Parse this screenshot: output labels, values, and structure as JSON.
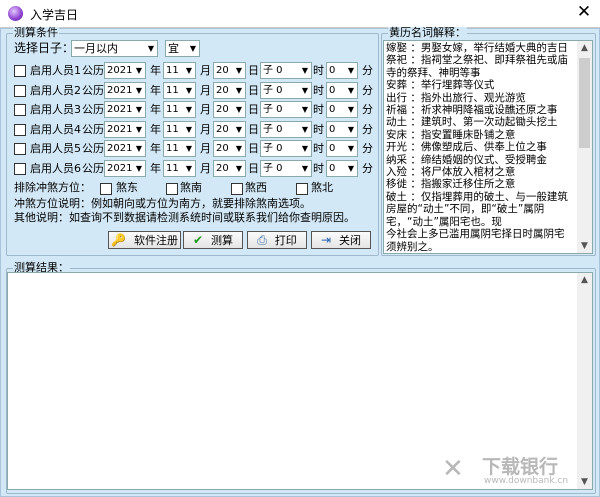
{
  "window": {
    "title": "入学吉日",
    "close": "✕"
  },
  "conditions": {
    "group_label": "测算条件",
    "select_day_label": "选择日子：",
    "range": "一月以内",
    "type": "宜",
    "persons": [
      {
        "label": "启用人员1",
        "calendar": "公历",
        "year": "2021",
        "month": "11",
        "day": "20",
        "hour": "子 0",
        "minute": "0",
        "checked": false
      },
      {
        "label": "启用人员2",
        "calendar": "公历",
        "year": "2021",
        "month": "11",
        "day": "20",
        "hour": "子 0",
        "minute": "0",
        "checked": false
      },
      {
        "label": "启用人员3",
        "calendar": "公历",
        "year": "2021",
        "month": "11",
        "day": "20",
        "hour": "子 0",
        "minute": "0",
        "checked": false
      },
      {
        "label": "启用人员4",
        "calendar": "公历",
        "year": "2021",
        "month": "11",
        "day": "20",
        "hour": "子 0",
        "minute": "0",
        "checked": false
      },
      {
        "label": "启用人员5",
        "calendar": "公历",
        "year": "2021",
        "month": "11",
        "day": "20",
        "hour": "子 0",
        "minute": "0",
        "checked": false
      },
      {
        "label": "启用人员6",
        "calendar": "公历",
        "year": "2021",
        "month": "11",
        "day": "20",
        "hour": "子 0",
        "minute": "0",
        "checked": false
      }
    ],
    "units": {
      "year": "年",
      "month": "月",
      "day": "日",
      "hour": "时",
      "minute": "分"
    },
    "exclude_label": "排除冲煞方位：",
    "directions": [
      "煞东",
      "煞南",
      "煞西",
      "煞北"
    ],
    "note1": "冲煞方位说明：例如朝向或方位为南方，就要排除煞南选项。",
    "note2": "其他说明：如查询不到数据请检测系统时间或联系我们给你查明原因。",
    "buttons": {
      "register": "软件注册",
      "calculate": "测算",
      "print": "打印",
      "close": "关闭"
    }
  },
  "glossary": {
    "group_label": "黄历名词解释：",
    "lines": [
      "嫁娶 ：男娶女嫁，举行结婚大典的吉日",
      "祭祀 ：指祠堂之祭祀、即拜祭祖先或庙",
      "寺的祭拜、神明等事",
      "安葬 ：举行埋葬等仪式",
      "出行 ：指外出旅行、观光游览",
      "祈福 ：祈求神明降福或设醮还原之事",
      "动土 ：建筑时、第一次动起锄头挖土",
      "安床 ：指安置睡床卧铺之意",
      "开光 ：佛像塑成后、供奉上位之事",
      "纳采 ：缔结婚姻的仪式、受授聘金",
      "入殓 ：将尸体放入棺材之意",
      "移徙 ：指搬家迁移住所之意",
      "破土 ：仅指埋葬用的破土、与一般建筑",
      "房屋的“动土”不同，即“破土”属阴",
      "宅，“动土”属阳宅也。现",
      "今社会上多已滥用属阴宅择日时属阴宅",
      "须辨别之。",
      "解除 ：指冲洗清扫宅舍、解除灾厄等事",
      "入宅 ：即迁入新宅、所谓“新居落成典"
    ]
  },
  "results": {
    "group_label": "测算结果：",
    "text": ""
  },
  "watermark": {
    "brand": "下载银行",
    "url": "www.downbank.cn"
  }
}
